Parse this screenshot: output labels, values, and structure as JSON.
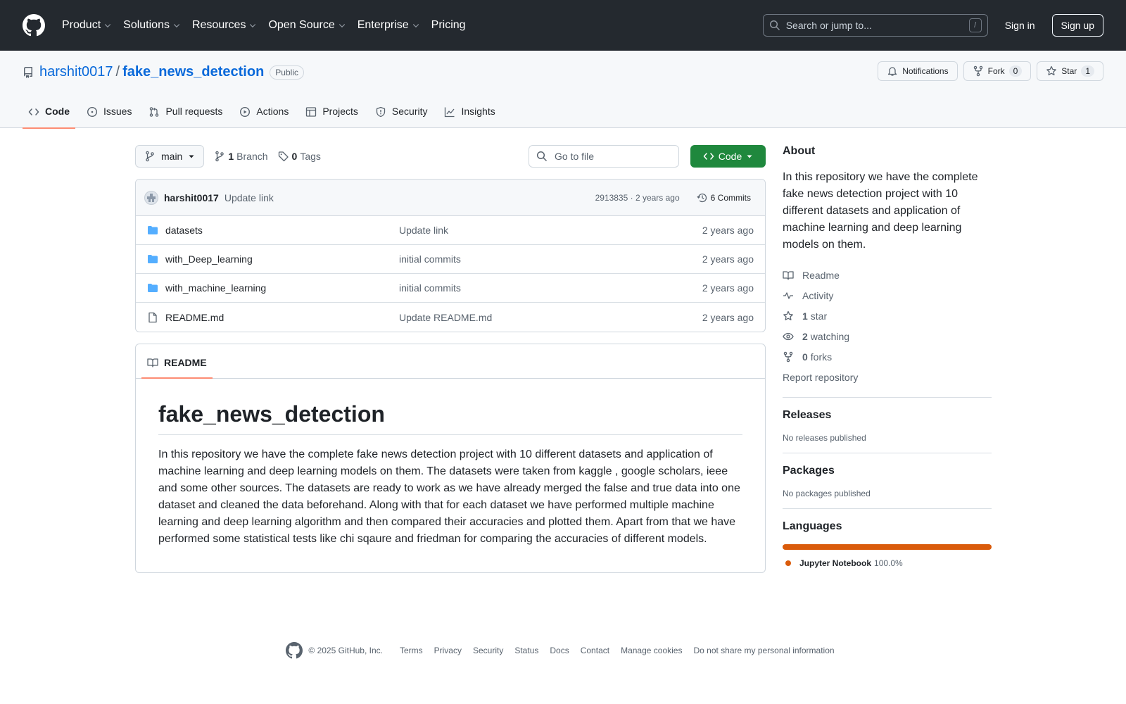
{
  "header": {
    "nav": [
      {
        "label": "Product",
        "dropdown": true
      },
      {
        "label": "Solutions",
        "dropdown": true
      },
      {
        "label": "Resources",
        "dropdown": true
      },
      {
        "label": "Open Source",
        "dropdown": true
      },
      {
        "label": "Enterprise",
        "dropdown": true
      },
      {
        "label": "Pricing",
        "dropdown": false
      }
    ],
    "search_placeholder": "Search or jump to...",
    "search_key": "/",
    "signin": "Sign in",
    "signup": "Sign up"
  },
  "repo": {
    "owner": "harshit0017",
    "separator": "/",
    "name": "fake_news_detection",
    "visibility": "Public",
    "notifications_label": "Notifications",
    "fork_label": "Fork",
    "fork_count": "0",
    "star_label": "Star",
    "star_count": "1",
    "tabs": [
      {
        "label": "Code",
        "icon": "code-icon",
        "active": true
      },
      {
        "label": "Issues",
        "icon": "issue-icon",
        "active": false
      },
      {
        "label": "Pull requests",
        "icon": "pull-request-icon",
        "active": false
      },
      {
        "label": "Actions",
        "icon": "play-icon",
        "active": false
      },
      {
        "label": "Projects",
        "icon": "table-icon",
        "active": false
      },
      {
        "label": "Security",
        "icon": "shield-icon",
        "active": false
      },
      {
        "label": "Insights",
        "icon": "graph-icon",
        "active": false
      }
    ]
  },
  "toolbar": {
    "branch": "main",
    "branch_count": "1",
    "branch_label": "Branch",
    "tag_count": "0",
    "tag_label": "Tags",
    "goto_placeholder": "Go to file",
    "code_button": "Code"
  },
  "commit": {
    "author": "harshit0017",
    "message": "Update link",
    "hash_time": "2913835 · 2 years ago",
    "commits_label": "6 Commits"
  },
  "files": [
    {
      "type": "folder",
      "name": "datasets",
      "message": "Update link",
      "date": "2 years ago"
    },
    {
      "type": "folder",
      "name": "with_Deep_learning",
      "message": "initial commits",
      "date": "2 years ago"
    },
    {
      "type": "folder",
      "name": "with_machine_learning",
      "message": "initial commits",
      "date": "2 years ago"
    },
    {
      "type": "file",
      "name": "README.md",
      "message": "Update README.md",
      "date": "2 years ago"
    }
  ],
  "readme": {
    "tab_label": "README",
    "title": "fake_news_detection",
    "body": "In this repository we have the complete fake news detection project with 10 different datasets and application of machine learning and deep learning models on them. The datasets were taken from kaggle , google scholars, ieee and some other sources. The datasets are ready to work as we have already merged the false and true data into one dataset and cleaned the data beforehand. Along with that for each dataset we have performed multiple machine learning and deep learning algorithm and then compared their accuracies and plotted them. Apart from that we have performed some statistical tests like chi sqaure and friedman for comparing the accuracies of different models."
  },
  "sidebar": {
    "about_heading": "About",
    "about_text": "In this repository we have the complete fake news detection project with 10 different datasets and application of machine learning and deep learning models on them.",
    "links": {
      "readme": "Readme",
      "activity": "Activity",
      "stars_count": "1",
      "stars_label": "star",
      "watching_count": "2",
      "watching_label": "watching",
      "forks_count": "0",
      "forks_label": "forks"
    },
    "report": "Report repository",
    "releases_heading": "Releases",
    "releases_text": "No releases published",
    "packages_heading": "Packages",
    "packages_text": "No packages published",
    "languages_heading": "Languages",
    "languages": [
      {
        "name": "Jupyter Notebook",
        "percent": "100.0%",
        "color": "#da5b0b",
        "fraction": 1.0
      }
    ]
  },
  "footer": {
    "copyright": "© 2025 GitHub, Inc.",
    "links": [
      "Terms",
      "Privacy",
      "Security",
      "Status",
      "Docs",
      "Contact",
      "Manage cookies",
      "Do not share my personal information"
    ]
  },
  "colors": {
    "header_bg": "#24292f",
    "link": "#0969da",
    "code_button": "#1f883d",
    "active_tab_underline": "#fd8c73",
    "folder": "#54aeff"
  }
}
